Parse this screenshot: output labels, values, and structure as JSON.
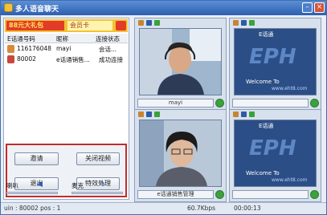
{
  "window": {
    "title": "多人语音聊天",
    "min_label": "–",
    "close_label": "×"
  },
  "banner": {
    "left": "88元大礼包",
    "right": "会员卡"
  },
  "list": {
    "headers": [
      "E话通号码",
      "昵称",
      "连接状态"
    ],
    "rows": [
      {
        "id": "116176048",
        "nick": "mayi",
        "status": "会话..."
      },
      {
        "id": "80002",
        "nick": "e话通销售...",
        "status": "成功连接"
      }
    ]
  },
  "controls": {
    "invite": "邀请",
    "close_video": "关闭视频",
    "exit": "退出",
    "effects": "特效处理"
  },
  "audio": {
    "speaker_label": "喇叭",
    "mic_label": "麦克"
  },
  "video_panels": [
    {
      "name": "mayi",
      "type": "person"
    },
    {
      "name": "",
      "type": "logo",
      "logo_title": "E话通",
      "logo_text": "EPH",
      "welcome": "Welcome To",
      "url": "www.eht8.com"
    },
    {
      "name": "e话通销售管理",
      "type": "person"
    },
    {
      "name": "",
      "type": "logo",
      "logo_title": "E话通",
      "logo_text": "EPH",
      "welcome": "Welcome To",
      "url": "www.eht8.com"
    }
  ],
  "status": {
    "left": "uin : 80002 pos : 1",
    "speed": "60.7Kbps",
    "time": "00:00:13"
  },
  "colors": {
    "title_bar": "#2c5fae",
    "highlight_border": "#c22c2c",
    "logo_bg": "#2c4e86",
    "ok_green": "#3ba13b"
  }
}
